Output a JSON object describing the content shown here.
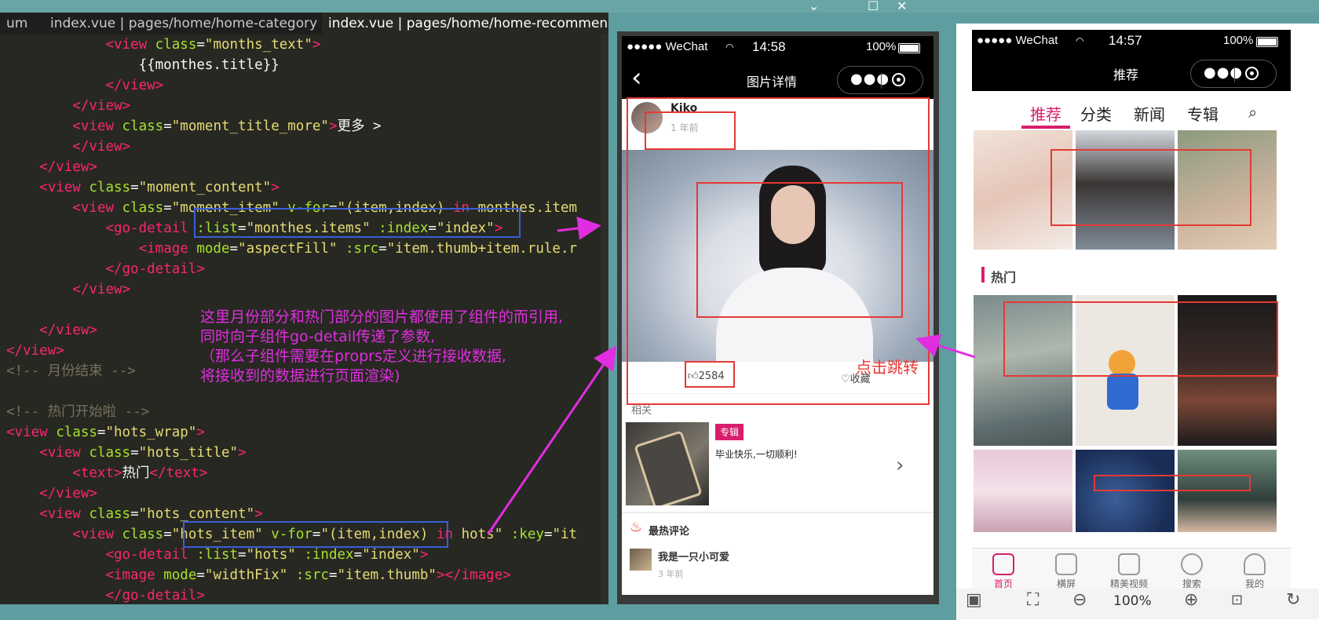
{
  "window": {
    "controls": [
      "⌄",
      "☐",
      "✕"
    ]
  },
  "editor": {
    "tabs": [
      {
        "label": "um"
      },
      {
        "label": "index.vue | pages/home/home-category"
      },
      {
        "label": "index.vue | pages/home/home-recommen"
      }
    ],
    "lines": [
      {
        "indent": "            ",
        "parts": [
          [
            "t",
            "<"
          ],
          [
            "t",
            "view"
          ],
          [
            "a",
            " class"
          ],
          [
            "w",
            "="
          ],
          [
            "s",
            "\"months_text\""
          ],
          [
            "t",
            ">"
          ]
        ]
      },
      {
        "indent": "                ",
        "parts": [
          [
            "w",
            "{{monthes.title}}"
          ]
        ]
      },
      {
        "indent": "            ",
        "parts": [
          [
            "t",
            "</"
          ],
          [
            "t",
            "view"
          ],
          [
            "t",
            ">"
          ]
        ]
      },
      {
        "indent": "        ",
        "parts": [
          [
            "t",
            "</"
          ],
          [
            "t",
            "view"
          ],
          [
            "t",
            ">"
          ]
        ]
      },
      {
        "indent": "        ",
        "parts": [
          [
            "t",
            "<"
          ],
          [
            "t",
            "view"
          ],
          [
            "a",
            " class"
          ],
          [
            "w",
            "="
          ],
          [
            "s",
            "\"moment_title_more\""
          ],
          [
            "t",
            ">"
          ],
          [
            "w",
            "更多 >"
          ]
        ]
      },
      {
        "indent": "        ",
        "parts": [
          [
            "t",
            "</"
          ],
          [
            "t",
            "view"
          ],
          [
            "t",
            ">"
          ]
        ]
      },
      {
        "indent": "    ",
        "parts": [
          [
            "t",
            "</"
          ],
          [
            "t",
            "view"
          ],
          [
            "t",
            ">"
          ]
        ]
      },
      {
        "indent": "    ",
        "parts": [
          [
            "t",
            "<"
          ],
          [
            "t",
            "view"
          ],
          [
            "a",
            " class"
          ],
          [
            "w",
            "="
          ],
          [
            "s",
            "\"moment_content\""
          ],
          [
            "t",
            ">"
          ]
        ]
      },
      {
        "indent": "        ",
        "parts": [
          [
            "t",
            "<"
          ],
          [
            "t",
            "view"
          ],
          [
            "a",
            " class"
          ],
          [
            "w",
            "="
          ],
          [
            "s",
            "\"moment_item\""
          ],
          [
            "a",
            " v-for"
          ],
          [
            "w",
            "="
          ],
          [
            "s",
            "\"(item,index) "
          ],
          [
            "k",
            "in"
          ],
          [
            "s",
            " monthes.item"
          ]
        ]
      },
      {
        "indent": "            ",
        "parts": [
          [
            "t",
            "<"
          ],
          [
            "t",
            "go-detail"
          ],
          [
            "a",
            " :list"
          ],
          [
            "w",
            "="
          ],
          [
            "s",
            "\"monthes.items\""
          ],
          [
            "a",
            " :index"
          ],
          [
            "w",
            "="
          ],
          [
            "s",
            "\"index\""
          ],
          [
            "t",
            ">"
          ]
        ]
      },
      {
        "indent": "                ",
        "parts": [
          [
            "t",
            "<"
          ],
          [
            "t",
            "image"
          ],
          [
            "a",
            " mode"
          ],
          [
            "w",
            "="
          ],
          [
            "s",
            "\"aspectFill\""
          ],
          [
            "a",
            " :src"
          ],
          [
            "w",
            "="
          ],
          [
            "s",
            "\"item.thumb+item.rule.r"
          ]
        ]
      },
      {
        "indent": "            ",
        "parts": [
          [
            "t",
            "</"
          ],
          [
            "t",
            "go-detail"
          ],
          [
            "t",
            ">"
          ]
        ]
      },
      {
        "indent": "        ",
        "parts": [
          [
            "t",
            "</"
          ],
          [
            "t",
            "view"
          ],
          [
            "t",
            ">"
          ]
        ]
      },
      {
        "indent": "",
        "parts": []
      },
      {
        "indent": "    ",
        "parts": [
          [
            "t",
            "</"
          ],
          [
            "t",
            "view"
          ],
          [
            "t",
            ">"
          ]
        ]
      },
      {
        "indent": "",
        "parts": [
          [
            "t",
            "</"
          ],
          [
            "t",
            "view"
          ],
          [
            "t",
            ">"
          ]
        ]
      },
      {
        "indent": "",
        "parts": [
          [
            "c",
            "<!-- 月份结束 -->"
          ]
        ]
      },
      {
        "indent": "",
        "parts": []
      },
      {
        "indent": "",
        "parts": [
          [
            "c",
            "<!-- 热门开始啦 -->"
          ]
        ]
      },
      {
        "indent": "",
        "parts": [
          [
            "t",
            "<"
          ],
          [
            "t",
            "view"
          ],
          [
            "a",
            " class"
          ],
          [
            "w",
            "="
          ],
          [
            "s",
            "\"hots_wrap\""
          ],
          [
            "t",
            ">"
          ]
        ]
      },
      {
        "indent": "    ",
        "parts": [
          [
            "t",
            "<"
          ],
          [
            "t",
            "view"
          ],
          [
            "a",
            " class"
          ],
          [
            "w",
            "="
          ],
          [
            "s",
            "\"hots_title\""
          ],
          [
            "t",
            ">"
          ]
        ]
      },
      {
        "indent": "        ",
        "parts": [
          [
            "t",
            "<"
          ],
          [
            "t",
            "text"
          ],
          [
            "t",
            ">"
          ],
          [
            "w",
            "热门"
          ],
          [
            "t",
            "</"
          ],
          [
            "t",
            "text"
          ],
          [
            "t",
            ">"
          ]
        ]
      },
      {
        "indent": "    ",
        "parts": [
          [
            "t",
            "</"
          ],
          [
            "t",
            "view"
          ],
          [
            "t",
            ">"
          ]
        ]
      },
      {
        "indent": "    ",
        "parts": [
          [
            "t",
            "<"
          ],
          [
            "t",
            "view"
          ],
          [
            "a",
            " class"
          ],
          [
            "w",
            "="
          ],
          [
            "s",
            "\"hots_content\""
          ],
          [
            "t",
            ">"
          ]
        ]
      },
      {
        "indent": "        ",
        "parts": [
          [
            "t",
            "<"
          ],
          [
            "t",
            "view"
          ],
          [
            "a",
            " class"
          ],
          [
            "w",
            "="
          ],
          [
            "s",
            "\"hots_item\""
          ],
          [
            "a",
            " v-for"
          ],
          [
            "w",
            "="
          ],
          [
            "s",
            "\"(item,index) "
          ],
          [
            "k",
            "in"
          ],
          [
            "s",
            " hots\""
          ],
          [
            "a",
            " :key"
          ],
          [
            "w",
            "="
          ],
          [
            "s",
            "\"it"
          ]
        ]
      },
      {
        "indent": "            ",
        "parts": [
          [
            "t",
            "<"
          ],
          [
            "t",
            "go-detail"
          ],
          [
            "a",
            " :list"
          ],
          [
            "w",
            "="
          ],
          [
            "s",
            "\"hots\""
          ],
          [
            "a",
            " :index"
          ],
          [
            "w",
            "="
          ],
          [
            "s",
            "\"index\""
          ],
          [
            "t",
            ">"
          ]
        ]
      },
      {
        "indent": "            ",
        "parts": [
          [
            "t",
            "<"
          ],
          [
            "t",
            "image"
          ],
          [
            "a",
            " mode"
          ],
          [
            "w",
            "="
          ],
          [
            "s",
            "\"widthFix\""
          ],
          [
            "a",
            " :src"
          ],
          [
            "w",
            "="
          ],
          [
            "s",
            "\"item.thumb\""
          ],
          [
            "t",
            ">"
          ],
          [
            "t",
            "</"
          ],
          [
            "t",
            "image"
          ],
          [
            "t",
            ">"
          ]
        ]
      },
      {
        "indent": "            ",
        "parts": [
          [
            "t",
            "</"
          ],
          [
            "t",
            "go-detail"
          ],
          [
            "t",
            ">"
          ]
        ]
      }
    ],
    "annotation": [
      "这里月份部分和热门部分的图片都使用了组件的而引用,",
      "同时向子组件go-detail传递了参数,",
      "（那么子组件需要在proprs定义进行接收数据,",
      "将接收到的数据进行页面渲染)"
    ]
  },
  "phone_detail": {
    "status": {
      "carrier": "●●●●● WeChat",
      "time": "14:58",
      "battery": "100%"
    },
    "nav_title": "图片详情",
    "back_icon": "‹",
    "user": {
      "name": "Kiko",
      "time": "1 年前"
    },
    "likes": "2584",
    "favorite": "收藏",
    "click_label": "点击跳转",
    "related_label": "相关",
    "album_tag": "专辑",
    "album_desc": "毕业快乐,一切顺利!",
    "hot_comments": "最热评论",
    "commenter": {
      "name": "我是一只小可爱",
      "time": "3 年前"
    }
  },
  "phone_home": {
    "status": {
      "carrier": "●●●●● WeChat",
      "time": "14:57",
      "battery": "100%"
    },
    "nav_title": "推荐",
    "tabs": [
      "推荐",
      "分类",
      "新闻",
      "专辑"
    ],
    "hot_label": "热门",
    "bottom_nav": [
      "首页",
      "横屏",
      "精美视频",
      "搜索",
      "我的"
    ],
    "accent": "#d81e6a"
  },
  "devtools_bar": {
    "zoom": "100%"
  }
}
